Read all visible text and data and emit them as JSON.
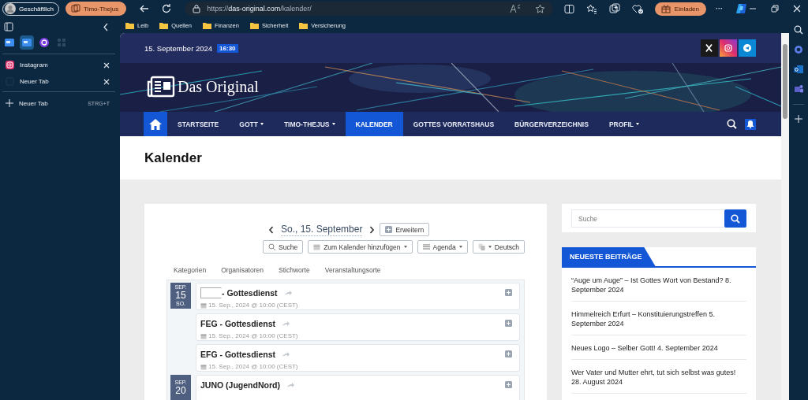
{
  "browser": {
    "profile": "Geschäftlich",
    "workspace": "Timo-Thejus",
    "url": {
      "scheme": "https://",
      "host": "das-original.com",
      "path": "/kalender/"
    },
    "invite_button": "Einladen",
    "more": "···"
  },
  "bookmarks": [
    "Leib",
    "Quellen",
    "Finanzen",
    "Sicherheit",
    "Versicherung"
  ],
  "sidebar": {
    "pinned": [
      {
        "kind": "app",
        "selected": false
      },
      {
        "kind": "app",
        "selected": true
      },
      {
        "kind": "copilot",
        "selected": false
      },
      {
        "kind": "grid",
        "selected": false
      }
    ],
    "tabs": [
      {
        "title": "Instagram",
        "kind": "instagram"
      },
      {
        "title": "Neuer Tab",
        "kind": "blank"
      }
    ],
    "new_tab": {
      "label": "Neuer Tab",
      "shortcut": "STRG+T"
    }
  },
  "site": {
    "date": "15. September 2024",
    "time": "16:30",
    "social": [
      {
        "kind": "x"
      },
      {
        "kind": "instagram"
      },
      {
        "kind": "telegram"
      }
    ],
    "logo": "Das Original",
    "nav": [
      {
        "label": "STARTSEITE",
        "dropdown": false,
        "selected": false
      },
      {
        "label": "GOTT",
        "dropdown": true,
        "selected": false
      },
      {
        "label": "TIMO-THEJUS",
        "dropdown": true,
        "selected": false
      },
      {
        "label": "KALENDER",
        "dropdown": false,
        "selected": true
      },
      {
        "label": "GOTTES VORRATSHAUS",
        "dropdown": false,
        "selected": false
      },
      {
        "label": "BÜRGERVERZEICHNIS",
        "dropdown": false,
        "selected": false
      },
      {
        "label": "PROFIL",
        "dropdown": true,
        "selected": false
      }
    ],
    "page_title": "Kalender"
  },
  "calendar": {
    "date": "So., 15. September",
    "expand_button": "Erweitern",
    "toolbar": [
      {
        "label": "Suche",
        "kind": "search",
        "dropdown": false
      },
      {
        "label": "Zum Kalender hinzufügen",
        "kind": "calendar",
        "dropdown": true
      },
      {
        "label": "Agenda",
        "kind": "list",
        "dropdown": true
      },
      {
        "label": "Deutsch",
        "kind": "language",
        "dropdown": true
      }
    ],
    "filters": [
      "Kategorien",
      "Organisatoren",
      "Stichworte",
      "Veranstaltungsorte"
    ],
    "days": [
      {
        "month": "SEP.",
        "day": "15",
        "weekday": "SO.",
        "events": [
          {
            "title": "- Gottesdienst",
            "redacted": true,
            "when": "15. Sep., 2024 @ 10:00 (CEST)"
          },
          {
            "title": "FEG - Gottesdienst",
            "redacted": false,
            "when": "15. Sep., 2024 @ 10:00 (CEST)"
          },
          {
            "title": "EFG - Gottesdienst",
            "redacted": false,
            "when": "15. Sep., 2024 @ 10:00 (CEST)"
          }
        ]
      },
      {
        "month": "SEP.",
        "day": "20",
        "events": [
          {
            "title": "JUNO (JugendNord)",
            "redacted": false
          }
        ]
      }
    ]
  },
  "widgets": {
    "search_placeholder": "Suche",
    "recent_title": "NEUESTE BEITRÄGE",
    "posts": [
      {
        "title": "“Auge um Auge” – Ist Gottes Wort von Bestand?",
        "date": "8. September 2024"
      },
      {
        "title": "Himmelreich Erfurt – Konstituierungstreffen",
        "date": "5. September 2024"
      },
      {
        "title": "Neues Logo – Selber Gott!",
        "date": "4. September 2024"
      },
      {
        "title": "Wer Vater und Mutter ehrt, tut sich selbst was gutes!",
        "date": "28. August 2024"
      }
    ]
  }
}
